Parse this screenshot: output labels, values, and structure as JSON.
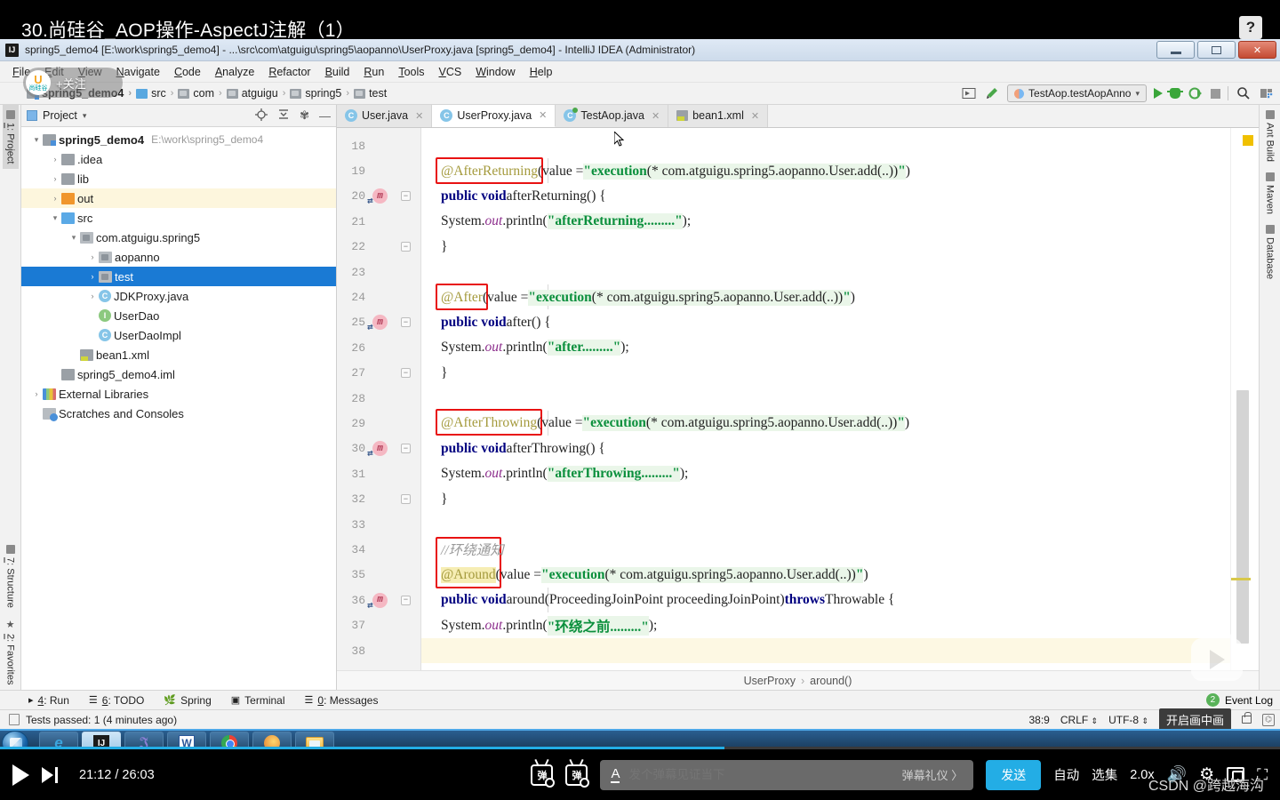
{
  "video": {
    "title": "30.尚硅谷_AOP操作-AspectJ注解（1）",
    "help_label": "?",
    "follow_brand": "尚硅谷",
    "follow_label": "+关注",
    "watermark": "CSDN @跨越海沟"
  },
  "window": {
    "title": "spring5_demo4 [E:\\work\\spring5_demo4] - ...\\src\\com\\atguigu\\spring5\\aopanno\\UserProxy.java [spring5_demo4] - IntelliJ IDEA (Administrator)",
    "logo": "IJ",
    "controls": {
      "minimize": "minimize-icon",
      "maximize": "maximize-icon",
      "close": "×"
    }
  },
  "menubar": {
    "items": [
      "File",
      "Edit",
      "View",
      "Navigate",
      "Code",
      "Analyze",
      "Refactor",
      "Build",
      "Run",
      "Tools",
      "VCS",
      "Window",
      "Help"
    ]
  },
  "navbar": {
    "crumbs": [
      "spring5_demo4",
      "src",
      "com",
      "atguigu",
      "spring5",
      "test"
    ],
    "run_config": "TestAop.testAopAnno",
    "icons": [
      "select-opened-file-icon",
      "hammer-build-icon",
      "run-icon",
      "debug-icon",
      "run-coverage-icon",
      "stop-icon",
      "search-everywhere-icon",
      "project-structure-icon"
    ]
  },
  "left_stripe": {
    "items": [
      {
        "num": "1",
        "label": ": Project",
        "active": true
      },
      {
        "num": "7",
        "label": ": Structure",
        "active": false
      },
      {
        "num": "2",
        "label": ": Favorites",
        "active": false
      }
    ]
  },
  "right_stripe": {
    "items": [
      "Ant Build",
      "Maven",
      "Database"
    ]
  },
  "project_panel": {
    "title": "Project",
    "tools": [
      "locate-icon",
      "collapse-all-icon",
      "settings-gear-icon",
      "hide-icon"
    ],
    "tree": [
      {
        "indent": 0,
        "arrow": "▾",
        "icon": "module",
        "label": "spring5_demo4",
        "bold": true,
        "path": "E:\\work\\spring5_demo4",
        "state": "normal"
      },
      {
        "indent": 1,
        "arrow": "›",
        "icon": "folder",
        "label": ".idea",
        "bold": false,
        "path": "",
        "state": "normal"
      },
      {
        "indent": 1,
        "arrow": "›",
        "icon": "folder",
        "label": "lib",
        "bold": false,
        "path": "",
        "state": "normal"
      },
      {
        "indent": 1,
        "arrow": "›",
        "icon": "folder-orange",
        "label": "out",
        "bold": false,
        "path": "",
        "state": "highlight"
      },
      {
        "indent": 1,
        "arrow": "▾",
        "icon": "folder-blue",
        "label": "src",
        "bold": false,
        "path": "",
        "state": "normal"
      },
      {
        "indent": 2,
        "arrow": "▾",
        "icon": "pkg",
        "label": "com.atguigu.spring5",
        "bold": false,
        "path": "",
        "state": "normal"
      },
      {
        "indent": 3,
        "arrow": "›",
        "icon": "pkg",
        "label": "aopanno",
        "bold": false,
        "path": "",
        "state": "normal"
      },
      {
        "indent": 3,
        "arrow": "›",
        "icon": "pkg",
        "label": "test",
        "bold": false,
        "path": "",
        "state": "selected"
      },
      {
        "indent": 3,
        "arrow": "›",
        "icon": "cls-new",
        "label": "JDKProxy.java",
        "bold": false,
        "path": "",
        "state": "normal"
      },
      {
        "indent": 3,
        "arrow": "",
        "icon": "iface",
        "label": "UserDao",
        "bold": false,
        "path": "",
        "state": "normal"
      },
      {
        "indent": 3,
        "arrow": "",
        "icon": "cls",
        "label": "UserDaoImpl",
        "bold": false,
        "path": "",
        "state": "normal"
      },
      {
        "indent": 2,
        "arrow": "",
        "icon": "xml",
        "label": "bean1.xml",
        "bold": false,
        "path": "",
        "state": "normal"
      },
      {
        "indent": 1,
        "arrow": "",
        "icon": "iml",
        "label": "spring5_demo4.iml",
        "bold": false,
        "path": "",
        "state": "normal"
      },
      {
        "indent": 0,
        "arrow": "›",
        "icon": "lib",
        "label": "External Libraries",
        "bold": false,
        "path": "",
        "state": "normal"
      },
      {
        "indent": 0,
        "arrow": "",
        "icon": "scratch",
        "label": "Scratches and Consoles",
        "bold": false,
        "path": "",
        "state": "normal"
      }
    ]
  },
  "editor": {
    "tabs": [
      {
        "label": "User.java",
        "icon": "class-icon",
        "active": false
      },
      {
        "label": "UserProxy.java",
        "icon": "class-icon",
        "active": true
      },
      {
        "label": "TestAop.java",
        "icon": "class-test-icon",
        "active": false
      },
      {
        "label": "bean1.xml",
        "icon": "xml-icon",
        "active": false
      }
    ],
    "first_line": 18,
    "lines": [
      {
        "n": 18,
        "marker": false,
        "fold": "",
        "current": false,
        "tokens": []
      },
      {
        "n": 19,
        "marker": false,
        "fold": "",
        "current": false,
        "tokens": [
          {
            "t": "@AfterReturning",
            "c": "ann",
            "box": "box-19"
          },
          {
            "t": "(value = ",
            "c": "plain"
          },
          {
            "t": "\"",
            "c": "str"
          },
          {
            "t": "execution",
            "c": "str-b"
          },
          {
            "t": "(* com.atguigu.spring5.aopanno.User.add(..))",
            "c": "exec"
          },
          {
            "t": "\"",
            "c": "str"
          },
          {
            "t": ")",
            "c": "plain"
          }
        ]
      },
      {
        "n": 20,
        "marker": true,
        "fold": "−",
        "current": false,
        "tokens": [
          {
            "t": "public void ",
            "c": "kw"
          },
          {
            "t": "afterReturning() {",
            "c": "plain"
          }
        ]
      },
      {
        "n": 21,
        "marker": false,
        "fold": "",
        "current": false,
        "tokens": [
          {
            "t": "    System.",
            "c": "plain"
          },
          {
            "t": "out",
            "c": "fld"
          },
          {
            "t": ".println(",
            "c": "plain"
          },
          {
            "t": "\"afterReturning.........\"",
            "c": "str"
          },
          {
            "t": ");",
            "c": "plain"
          }
        ]
      },
      {
        "n": 22,
        "marker": false,
        "fold": "−",
        "current": false,
        "tokens": [
          {
            "t": "}",
            "c": "plain"
          }
        ]
      },
      {
        "n": 23,
        "marker": false,
        "fold": "",
        "current": false,
        "tokens": []
      },
      {
        "n": 24,
        "marker": false,
        "fold": "",
        "current": false,
        "tokens": [
          {
            "t": "@After",
            "c": "ann",
            "box": "box-24"
          },
          {
            "t": "(value = ",
            "c": "plain"
          },
          {
            "t": "\"",
            "c": "str"
          },
          {
            "t": "execution",
            "c": "str-b"
          },
          {
            "t": "(* com.atguigu.spring5.aopanno.User.add(..))",
            "c": "exec"
          },
          {
            "t": "\"",
            "c": "str"
          },
          {
            "t": ")",
            "c": "plain"
          }
        ]
      },
      {
        "n": 25,
        "marker": true,
        "fold": "−",
        "current": false,
        "tokens": [
          {
            "t": "public void ",
            "c": "kw"
          },
          {
            "t": "after() {",
            "c": "plain"
          }
        ]
      },
      {
        "n": 26,
        "marker": false,
        "fold": "",
        "current": false,
        "tokens": [
          {
            "t": "    System.",
            "c": "plain"
          },
          {
            "t": "out",
            "c": "fld"
          },
          {
            "t": ".println(",
            "c": "plain"
          },
          {
            "t": "\"after.........\"",
            "c": "str"
          },
          {
            "t": ");",
            "c": "plain"
          }
        ]
      },
      {
        "n": 27,
        "marker": false,
        "fold": "−",
        "current": false,
        "tokens": [
          {
            "t": "}",
            "c": "plain"
          }
        ]
      },
      {
        "n": 28,
        "marker": false,
        "fold": "",
        "current": false,
        "tokens": []
      },
      {
        "n": 29,
        "marker": false,
        "fold": "",
        "current": false,
        "tokens": [
          {
            "t": "@AfterThrowing",
            "c": "ann",
            "box": "box-29"
          },
          {
            "t": "(value = ",
            "c": "plain"
          },
          {
            "t": "\"",
            "c": "str"
          },
          {
            "t": "execution",
            "c": "str-b"
          },
          {
            "t": "(* com.atguigu.spring5.aopanno.User.add(..))",
            "c": "exec"
          },
          {
            "t": "\"",
            "c": "str"
          },
          {
            "t": ")",
            "c": "plain"
          }
        ]
      },
      {
        "n": 30,
        "marker": true,
        "fold": "−",
        "current": false,
        "tokens": [
          {
            "t": "public void ",
            "c": "kw"
          },
          {
            "t": "afterThrowing() {",
            "c": "plain"
          }
        ]
      },
      {
        "n": 31,
        "marker": false,
        "fold": "",
        "current": false,
        "tokens": [
          {
            "t": "    System.",
            "c": "plain"
          },
          {
            "t": "out",
            "c": "fld"
          },
          {
            "t": ".println(",
            "c": "plain"
          },
          {
            "t": "\"afterThrowing.........\"",
            "c": "str"
          },
          {
            "t": ");",
            "c": "plain"
          }
        ]
      },
      {
        "n": 32,
        "marker": false,
        "fold": "−",
        "current": false,
        "tokens": [
          {
            "t": "}",
            "c": "plain"
          }
        ]
      },
      {
        "n": 33,
        "marker": false,
        "fold": "",
        "current": false,
        "tokens": []
      },
      {
        "n": 34,
        "marker": false,
        "fold": "",
        "current": false,
        "tokens": [
          {
            "t": "//环绕通知",
            "c": "cmt"
          }
        ]
      },
      {
        "n": 35,
        "marker": false,
        "fold": "",
        "current": false,
        "tokens": [
          {
            "t": "@Around",
            "c": "ann-hl",
            "box": "box-35"
          },
          {
            "t": "(value = ",
            "c": "plain"
          },
          {
            "t": "\"",
            "c": "str"
          },
          {
            "t": "execution",
            "c": "str-b"
          },
          {
            "t": "(* com.atguigu.spring5.aopanno.User.add(..))",
            "c": "exec"
          },
          {
            "t": "\"",
            "c": "str"
          },
          {
            "t": ")",
            "c": "plain"
          }
        ]
      },
      {
        "n": 36,
        "marker": true,
        "fold": "−",
        "current": false,
        "tokens": [
          {
            "t": "public void ",
            "c": "kw"
          },
          {
            "t": "around(ProceedingJoinPoint proceedingJoinPoint) ",
            "c": "plain"
          },
          {
            "t": "throws ",
            "c": "kw"
          },
          {
            "t": "Throwable {",
            "c": "plain"
          }
        ]
      },
      {
        "n": 37,
        "marker": false,
        "fold": "",
        "current": false,
        "tokens": [
          {
            "t": "    System.",
            "c": "plain"
          },
          {
            "t": "out",
            "c": "fld"
          },
          {
            "t": ".println(",
            "c": "plain"
          },
          {
            "t": "\"环绕之前.........\"",
            "c": "str"
          },
          {
            "t": ");",
            "c": "plain"
          }
        ]
      },
      {
        "n": 38,
        "marker": false,
        "fold": "",
        "current": true,
        "tokens": []
      }
    ],
    "breadcrumb": [
      "UserProxy",
      "around()"
    ]
  },
  "bottom_stripe": {
    "items": [
      {
        "num": "4",
        "label": ": Run",
        "icon": "run-icon"
      },
      {
        "num": "6",
        "label": ": TODO",
        "icon": "todo-icon"
      },
      {
        "num": "",
        "label": "Spring",
        "icon": "spring-leaf-icon"
      },
      {
        "num": "",
        "label": "Terminal",
        "icon": "terminal-icon"
      },
      {
        "num": "0",
        "label": ": Messages",
        "icon": "messages-icon"
      }
    ],
    "event_log": "Event Log",
    "event_log_count": "2"
  },
  "status_bar": {
    "message": "Tests passed: 1 (4 minutes ago)",
    "caret": "38:9",
    "line_sep": "CRLF",
    "encoding": "UTF-8",
    "tooltip": "开启画中画"
  },
  "taskbar": {
    "apps": [
      "internet-explorer-icon",
      "intellij-idea-icon",
      "navicat-icon",
      "word-icon",
      "chrome-icon",
      "paint-icon",
      "file-explorer-icon"
    ]
  },
  "player": {
    "current_time": "21:12",
    "total_time": "26:03",
    "danmaku_placeholder": "发个弹幕见证当下",
    "danmaku_etiquette": "弹幕礼仪 〉",
    "send_label": "发送",
    "quality_label": "自动",
    "episodes_label": "选集",
    "speed_label": "2.0x",
    "icons": [
      "play-icon",
      "next-episode-icon",
      "danmaku-off-icon",
      "danmaku-settings-icon",
      "volume-icon",
      "settings-gear-icon",
      "pip-icon",
      "fullscreen-icon"
    ]
  }
}
